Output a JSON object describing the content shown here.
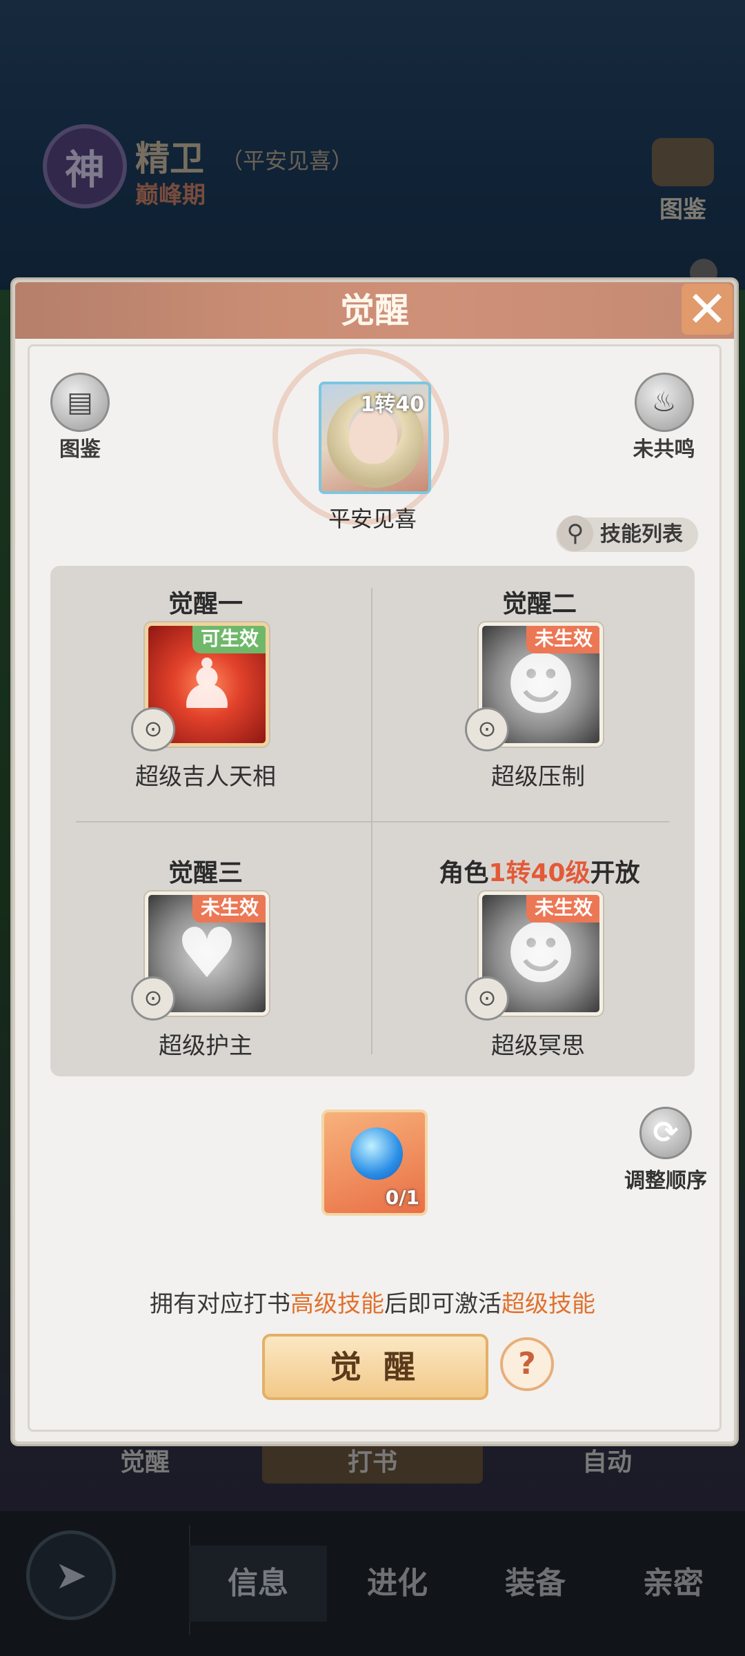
{
  "background": {
    "shen_label": "神",
    "character_name": "精卫",
    "character_sub": "（平安见喜）",
    "character_stage": "巅峰期",
    "tujian_label": "图鉴",
    "under_left": "觉醒",
    "under_mid": "打书",
    "under_right": "自动"
  },
  "bottom_nav": {
    "tabs": [
      {
        "label": "信息"
      },
      {
        "label": "进化"
      },
      {
        "label": "装备"
      },
      {
        "label": "亲密"
      }
    ]
  },
  "modal": {
    "title": "觉醒",
    "close_glyph": "✕",
    "tujian_label": "图鉴",
    "resonance_label": "未共鸣",
    "avatar_level": "1转40",
    "avatar_name": "平安见喜",
    "skill_list_label": "技能列表",
    "cells": [
      {
        "title": "觉醒一",
        "tag": "可生效",
        "name": "超级吉人天相"
      },
      {
        "title": "觉醒二",
        "tag": "未生效",
        "name": "超级压制"
      },
      {
        "title": "觉醒三",
        "tag": "未生效",
        "name": "超级护主"
      },
      {
        "title_prefix": "角色",
        "title_highlight": "1转40级",
        "title_suffix": "开放",
        "tag": "未生效",
        "name": "超级冥思"
      }
    ],
    "item_count": "0/1",
    "reorder_label": "调整顺序",
    "hint": {
      "part1": "拥有对应打书",
      "hl1": "高级技能",
      "part2": "后即可激活",
      "hl2": "超级技能"
    },
    "awaken_button": "觉 醒",
    "help_glyph": "?"
  },
  "colors": {
    "accent_orange": "#e0712e",
    "tag_green": "#6fb86a",
    "tag_orange": "#ec7755",
    "header": "#c98d74"
  }
}
